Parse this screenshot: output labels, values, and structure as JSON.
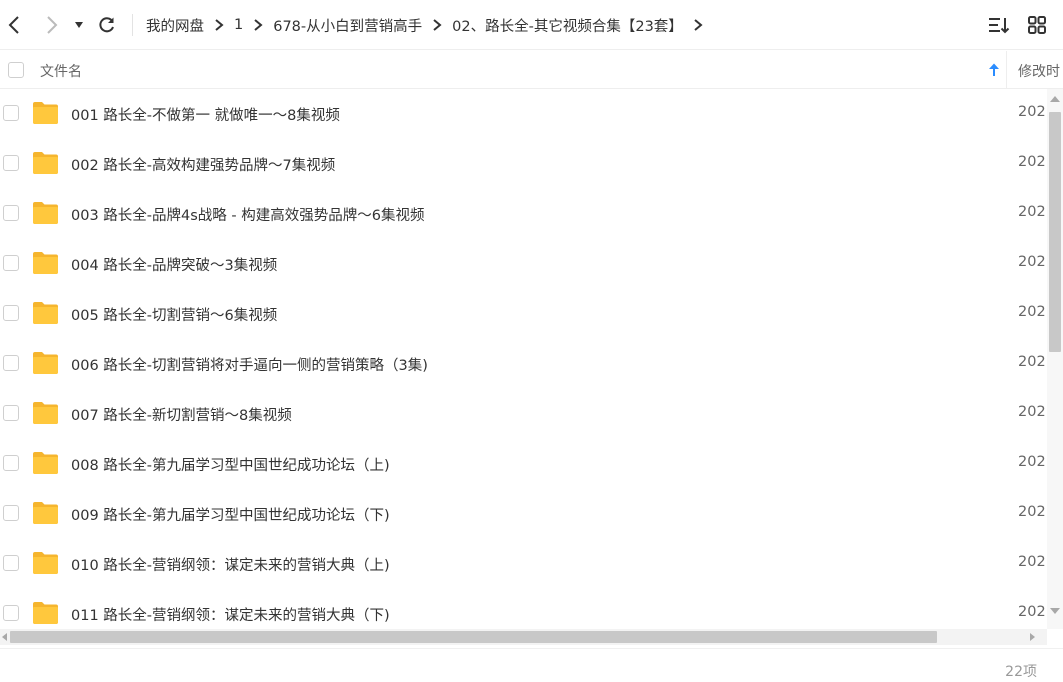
{
  "toolbar": {
    "back_icon": "chevron-left-icon",
    "forward_icon": "chevron-right-icon",
    "history_icon": "caret-down-icon",
    "refresh_icon": "refresh-icon",
    "sort_icon": "sort-list-icon",
    "view_icon": "grid-view-icon"
  },
  "breadcrumb": [
    "我的网盘",
    "1",
    "678-从小白到营销高手",
    "02、路长全-其它视频合集【23套】"
  ],
  "table": {
    "columns": {
      "name": "文件名",
      "modified": "修改时"
    },
    "sort_icon": "arrow-up-icon",
    "rows": [
      {
        "name": "001 路长全-不做第一 就做唯一～8集视频",
        "modified": "202"
      },
      {
        "name": "002 路长全-高效构建强势品牌～7集视频",
        "modified": "202"
      },
      {
        "name": "003 路长全-品牌4s战略 - 构建高效强势品牌～6集视频",
        "modified": "202"
      },
      {
        "name": "004 路长全-品牌突破～3集视频",
        "modified": "202"
      },
      {
        "name": "005 路长全-切割营销～6集视频",
        "modified": "202"
      },
      {
        "name": "006 路长全-切割营销将对手逼向一侧的营销策略（3集)",
        "modified": "202"
      },
      {
        "name": "007 路长全-新切割营销～8集视频",
        "modified": "202"
      },
      {
        "name": "008 路长全-第九届学习型中国世纪成功论坛（上)",
        "modified": "202"
      },
      {
        "name": "009 路长全-第九届学习型中国世纪成功论坛（下)",
        "modified": "202"
      },
      {
        "name": "010 路长全-营销纲领：谋定未来的营销大典（上)",
        "modified": "202"
      },
      {
        "name": "011 路长全-营销纲领：谋定未来的营销大典（下)",
        "modified": "202"
      }
    ]
  },
  "status": {
    "count": "22项"
  },
  "colors": {
    "folder": "#FFC83D",
    "folder_dark": "#F5B52E",
    "accent": "#2A8CFF",
    "border": "#EEEEEE",
    "scroll_thumb": "#C8C8C8"
  }
}
